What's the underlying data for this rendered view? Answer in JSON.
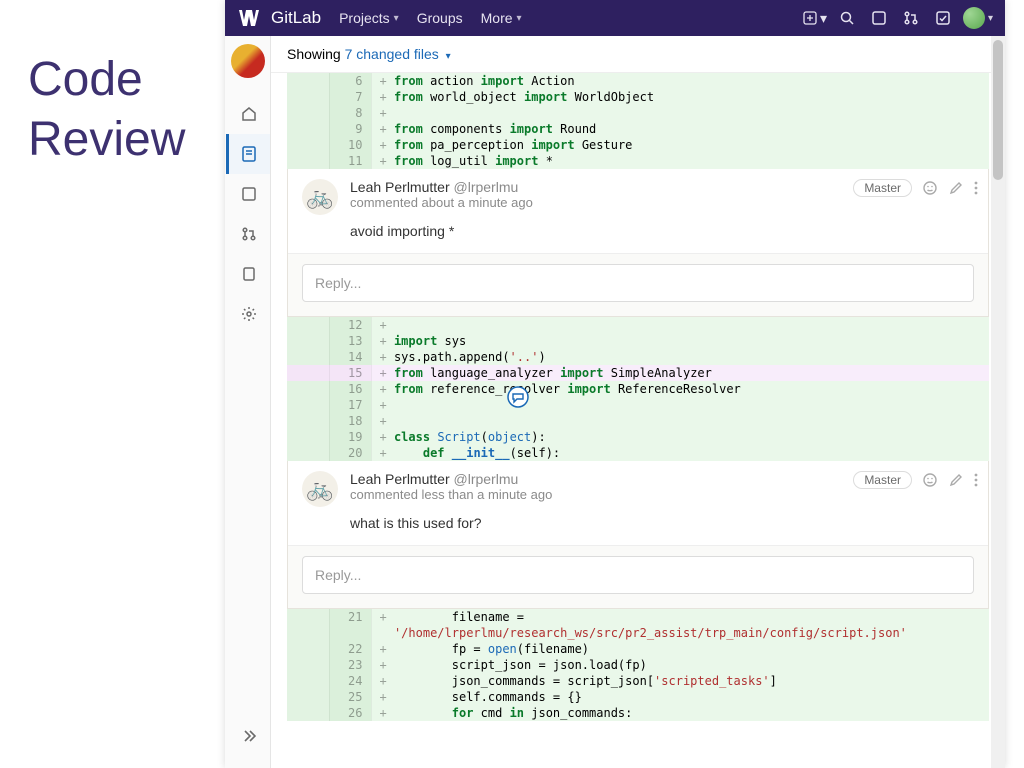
{
  "slide_title_line1": "Code",
  "slide_title_line2": "Review",
  "topnav": {
    "brand": "GitLab",
    "projects": "Projects",
    "groups": "Groups",
    "more": "More"
  },
  "showing": {
    "prefix": "Showing ",
    "link": "7 changed files"
  },
  "code_block_a": [
    {
      "n": 6,
      "tokens": [
        [
          "kw",
          "from"
        ],
        [
          "",
          " action "
        ],
        [
          "kw",
          "import"
        ],
        [
          "",
          " Action"
        ]
      ]
    },
    {
      "n": 7,
      "tokens": [
        [
          "kw",
          "from"
        ],
        [
          "",
          " world_object "
        ],
        [
          "kw",
          "import"
        ],
        [
          "",
          " WorldObject"
        ]
      ]
    },
    {
      "n": 8,
      "tokens": []
    },
    {
      "n": 9,
      "tokens": [
        [
          "kw",
          "from"
        ],
        [
          "",
          " components "
        ],
        [
          "kw",
          "import"
        ],
        [
          "",
          " Round"
        ]
      ]
    },
    {
      "n": 10,
      "tokens": [
        [
          "kw",
          "from"
        ],
        [
          "",
          " pa_perception "
        ],
        [
          "kw",
          "import"
        ],
        [
          "",
          " Gesture"
        ]
      ]
    },
    {
      "n": 11,
      "tokens": [
        [
          "kw",
          "from"
        ],
        [
          "",
          " log_util "
        ],
        [
          "kw",
          "import"
        ],
        [
          "",
          " *"
        ]
      ]
    }
  ],
  "comment_a": {
    "name": "Leah Perlmutter",
    "handle": "@lrperlmu",
    "time": "commented about a minute ago",
    "badge": "Master",
    "body": "avoid importing *",
    "reply_placeholder": "Reply..."
  },
  "code_block_b": [
    {
      "n": 12,
      "tokens": []
    },
    {
      "n": 13,
      "tokens": [
        [
          "kw",
          "import"
        ],
        [
          "",
          " sys"
        ]
      ]
    },
    {
      "n": 14,
      "tokens": [
        [
          "",
          "sys.path.append("
        ],
        [
          "str",
          "'..'"
        ],
        [
          "",
          ")"
        ]
      ]
    },
    {
      "n": 15,
      "hl": true,
      "tokens": [
        [
          "kw",
          "from"
        ],
        [
          "",
          " language_analyzer "
        ],
        [
          "kw",
          "import"
        ],
        [
          "",
          " SimpleAnalyzer"
        ]
      ]
    },
    {
      "n": 16,
      "tokens": [
        [
          "kw",
          "from"
        ],
        [
          "",
          " reference_resolver "
        ],
        [
          "kw",
          "import"
        ],
        [
          "",
          " ReferenceResolver"
        ]
      ]
    },
    {
      "n": 17,
      "tokens": []
    },
    {
      "n": 18,
      "tokens": []
    },
    {
      "n": 19,
      "tokens": [
        [
          "kw",
          "class"
        ],
        [
          "",
          " "
        ],
        [
          "builtin",
          "Script"
        ],
        [
          "",
          "("
        ],
        [
          "builtin",
          "object"
        ],
        [
          "",
          "):"
        ]
      ]
    },
    {
      "n": 20,
      "tokens": [
        [
          "",
          "    "
        ],
        [
          "kw",
          "def"
        ],
        [
          "",
          " "
        ],
        [
          "dunder",
          "__init__"
        ],
        [
          "",
          "(self):"
        ]
      ]
    }
  ],
  "comment_b": {
    "name": "Leah Perlmutter",
    "handle": "@lrperlmu",
    "time": "commented less than a minute ago",
    "badge": "Master",
    "body": "what is this used for?",
    "reply_placeholder": "Reply..."
  },
  "code_block_c": [
    {
      "n": 21,
      "tokens": [
        [
          "",
          "        filename = "
        ]
      ]
    },
    {
      "n": "",
      "tokens": [
        [
          "path-str",
          "'/home/lrperlmu/research_ws/src/pr2_assist/trp_main/config/script.json'"
        ]
      ]
    },
    {
      "n": 22,
      "tokens": [
        [
          "",
          "        fp = "
        ],
        [
          "builtin",
          "open"
        ],
        [
          "",
          "(filename)"
        ]
      ]
    },
    {
      "n": 23,
      "tokens": [
        [
          "",
          "        script_json = json.load(fp)"
        ]
      ]
    },
    {
      "n": 24,
      "tokens": [
        [
          "",
          "        json_commands = script_json["
        ],
        [
          "str",
          "'scripted_tasks'"
        ],
        [
          "",
          "]"
        ]
      ]
    },
    {
      "n": 25,
      "tokens": [
        [
          "",
          "        self.commands = {}"
        ]
      ]
    },
    {
      "n": 26,
      "tokens": [
        [
          "",
          "        "
        ],
        [
          "kw",
          "for"
        ],
        [
          "",
          " cmd "
        ],
        [
          "kw",
          "in"
        ],
        [
          "",
          " json_commands:"
        ]
      ]
    }
  ]
}
